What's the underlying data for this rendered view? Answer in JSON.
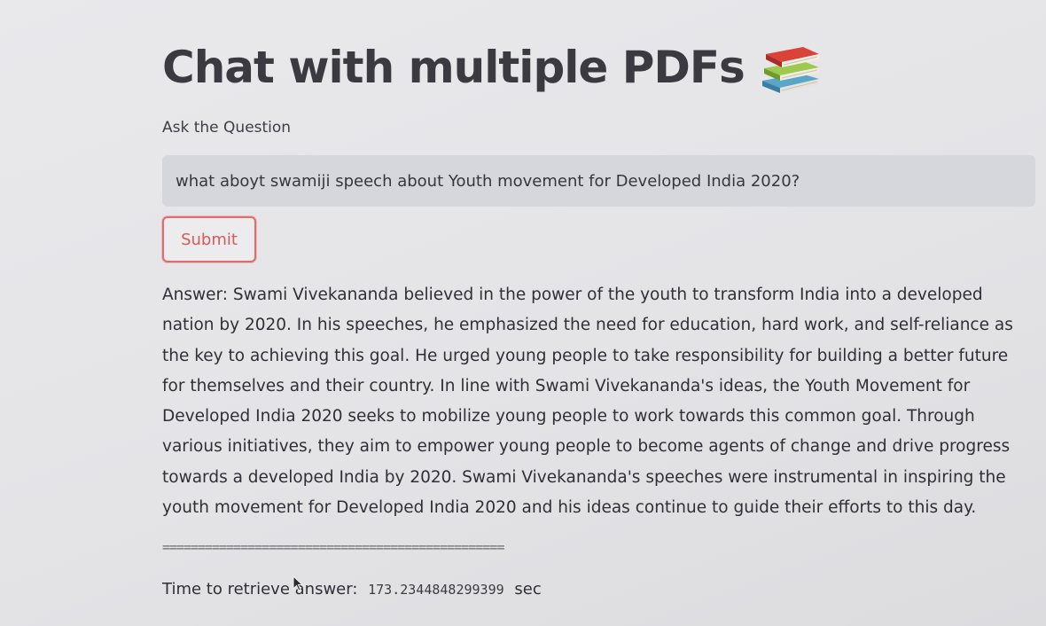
{
  "header": {
    "title": "Chat with multiple PDFs",
    "title_icon": "books-icon"
  },
  "question": {
    "label": "Ask the Question",
    "value": "what aboyt swamiji speech about Youth movement for Developed India 2020?"
  },
  "submit": {
    "label": "Submit"
  },
  "answer": {
    "text": "Answer: Swami Vivekananda believed in the power of the youth to transform India into a developed nation by 2020. In his speeches, he emphasized the need for education, hard work, and self-reliance as the key to achieving this goal. He urged young people to take responsibility for building a better future for themselves and their country. In line with Swami Vivekananda's ideas, the Youth Movement for Developed India 2020 seeks to mobilize young people to work towards this common goal. Through various initiatives, they aim to empower young people to become agents of change and drive progress towards a developed India by 2020. Swami Vivekananda's speeches were instrumental in inspiring the youth movement for Developed India 2020 and his ideas continue to guide their efforts to this day."
  },
  "divider": "================================================",
  "timing": {
    "label": "Time to retrieve answer:",
    "value": "173.2344848299399",
    "unit": "sec"
  },
  "colors": {
    "accent": "#e06c6c",
    "input_bg": "#d6d7dc",
    "text": "#31333f"
  }
}
